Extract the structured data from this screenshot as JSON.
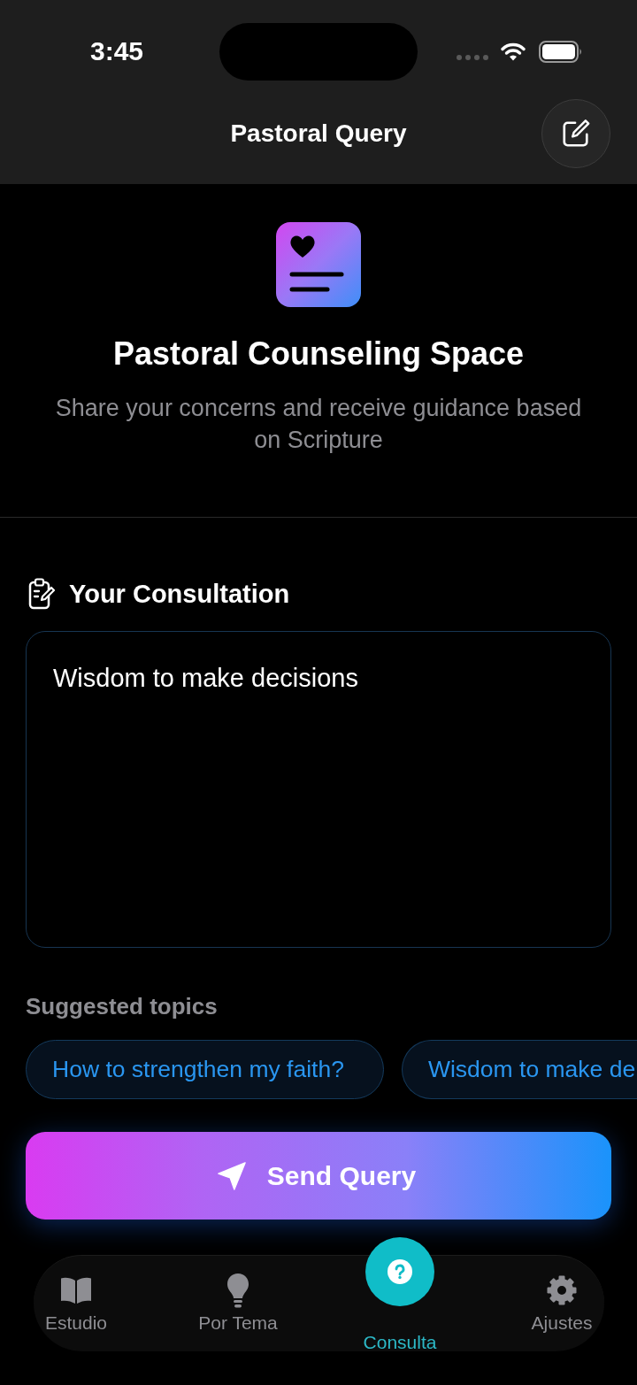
{
  "status_bar": {
    "time": "3:45"
  },
  "nav": {
    "title": "Pastoral Query"
  },
  "hero": {
    "title": "Pastoral Counseling Space",
    "subtitle": "Share your concerns and receive guidance based on Scripture"
  },
  "consultation": {
    "heading": "Your Consultation",
    "value": "Wisdom to make decisions"
  },
  "suggestions": {
    "heading": "Suggested topics",
    "topics": [
      "How to strengthen my faith?",
      "Wisdom to make de"
    ]
  },
  "send_button": {
    "label": "Send Query"
  },
  "tab_bar": {
    "tabs": [
      {
        "label": "Estudio",
        "selected": false
      },
      {
        "label": "Por Tema",
        "selected": false
      },
      {
        "label": "Consulta",
        "selected": true
      },
      {
        "label": "Ajustes",
        "selected": false
      }
    ]
  }
}
